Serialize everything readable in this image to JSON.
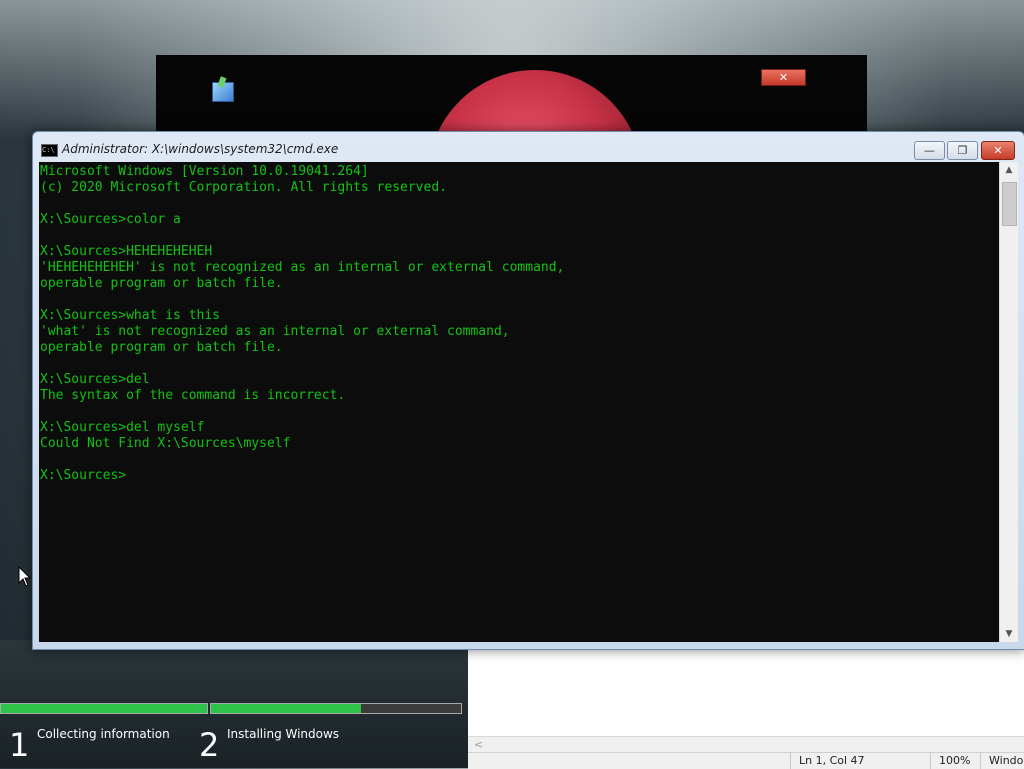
{
  "cmd": {
    "title": "Administrator: X:\\windows\\system32\\cmd.exe",
    "icon_text": "C:\\",
    "buttons": {
      "minimize": "—",
      "maximize": "❐",
      "close": "✕"
    },
    "lines": [
      "Microsoft Windows [Version 10.0.19041.264]",
      "(c) 2020 Microsoft Corporation. All rights reserved.",
      "",
      "X:\\Sources>color a",
      "",
      "X:\\Sources>HEHEHEHEHEH",
      "'HEHEHEHEHEH' is not recognized as an internal or external command,",
      "operable program or batch file.",
      "",
      "X:\\Sources>what is this",
      "'what' is not recognized as an internal or external command,",
      "operable program or batch file.",
      "",
      "X:\\Sources>del",
      "The syntax of the command is incorrect.",
      "",
      "X:\\Sources>del myself",
      "Could Not Find X:\\Sources\\myself",
      "",
      "X:\\Sources>"
    ],
    "text_color": "#13c213",
    "scroll": {
      "up": "▲",
      "down": "▼"
    }
  },
  "setup_window": {
    "close_label": "✕"
  },
  "progress": {
    "steps": [
      {
        "number": "1",
        "label": "Collecting information",
        "fill": 1.0
      },
      {
        "number": "2",
        "label": "Installing Windows",
        "fill": 0.6
      }
    ],
    "fill_color": "#2fc24a"
  },
  "editor_statusbar": {
    "scroll_arrow": "<",
    "position": "Ln 1, Col 47",
    "zoom": "100%",
    "line_ending": "Windo"
  }
}
